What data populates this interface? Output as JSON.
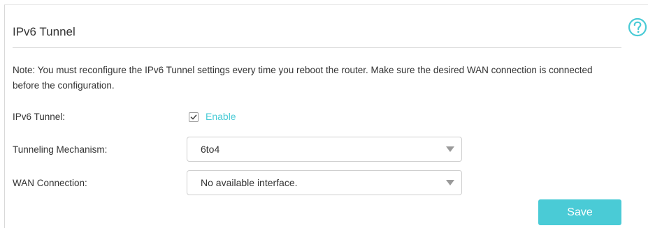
{
  "section": {
    "title": "IPv6 Tunnel"
  },
  "note": "Note: You must reconfigure the IPv6 Tunnel settings every time you reboot the router. Make sure the desired WAN connection is connected before the configuration.",
  "form": {
    "tunnel": {
      "label": "IPv6 Tunnel:",
      "checkbox_label": "Enable",
      "checked": true
    },
    "mechanism": {
      "label": "Tunneling Mechanism:",
      "value": "6to4"
    },
    "wan": {
      "label": "WAN Connection:",
      "value": "No available interface."
    }
  },
  "actions": {
    "save_label": "Save"
  },
  "icons": {
    "help": "help-icon",
    "check": "check-icon",
    "dropdown": "dropdown-arrow-icon"
  },
  "colors": {
    "accent": "#4acbd6",
    "text": "#333333",
    "border": "#cfcfcf"
  }
}
